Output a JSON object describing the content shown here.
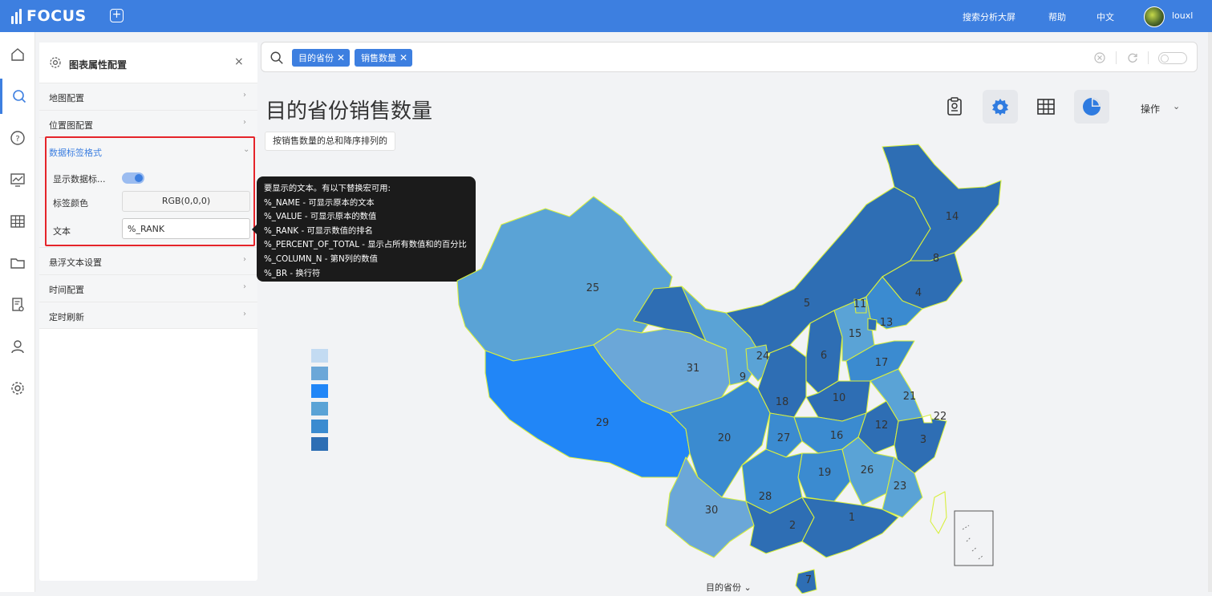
{
  "header": {
    "logo_text": "FOCUS",
    "links": [
      "搜索分析大屏",
      "帮助",
      "中文"
    ],
    "username": "louxl"
  },
  "nav": {
    "icons": [
      "home-icon",
      "search-icon",
      "help-icon",
      "dashboard-icon",
      "table-icon",
      "folder-icon",
      "report-settings-icon",
      "user-icon",
      "settings-icon"
    ],
    "active": "search-icon"
  },
  "panel": {
    "title": "图表属性配置",
    "close": "×",
    "sections": [
      {
        "label": "地图配置",
        "arrow": "›"
      },
      {
        "label": "位置图配置",
        "arrow": "›"
      },
      {
        "label": "数据标签格式",
        "arrow": "⌄",
        "open": true
      },
      {
        "label": "悬浮文本设置",
        "arrow": "›"
      },
      {
        "label": "时间配置",
        "arrow": "›"
      },
      {
        "label": "定时刷新",
        "arrow": "›"
      }
    ],
    "label_format": {
      "show_label": "显示数据标...",
      "show_label_on": true,
      "color_label": "标签颜色",
      "color_value": "RGB(0,0,0)",
      "text_label": "文本",
      "text_value": "%_RANK"
    }
  },
  "tooltip": {
    "lines": [
      "要显示的文本。有以下替换宏可用:",
      "%_NAME - 可显示原本的文本",
      "%_VALUE - 可显示原本的数值",
      "%_RANK - 可显示数值的排名",
      "%_PERCENT_OF_TOTAL - 显示占所有数值和的百分比",
      "%_COLUMN_N - 第N列的数值",
      "%_BR - 换行符"
    ]
  },
  "search": {
    "tags": [
      "目的省份",
      "销售数量"
    ]
  },
  "chart": {
    "title": "目的省份销售数量",
    "sort_hint": "按销售数量的总和降序排列的",
    "ops_label": "操作",
    "x_axis_caption": "目的省份",
    "legend_colors": [
      "#c3dbf2",
      "#6ba7d8",
      "#2186f7",
      "#5aa3d6",
      "#3b8bd0",
      "#2e6eb4"
    ],
    "region_labels": [
      "1",
      "2",
      "3",
      "4",
      "5",
      "6",
      "7",
      "8",
      "9",
      "10",
      "11",
      "12",
      "13",
      "14",
      "15",
      "16",
      "17",
      "18",
      "19",
      "20",
      "21",
      "22",
      "23",
      "24",
      "25",
      "26",
      "27",
      "28",
      "29",
      "30",
      "31"
    ]
  }
}
